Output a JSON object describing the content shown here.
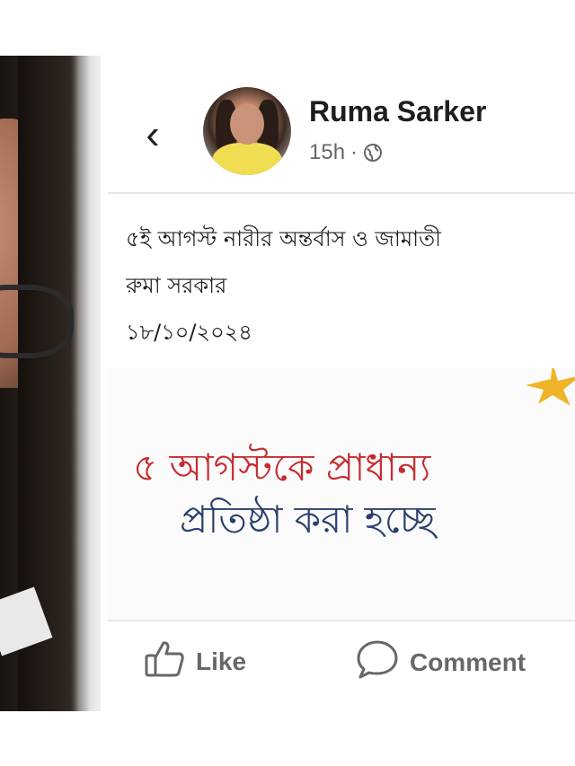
{
  "post": {
    "author_name": "Ruma Sarker",
    "time": "15h",
    "separator": "·",
    "privacy_icon": "globe-icon",
    "text_lines": [
      "৫ই আগস্ট নারীর অন্তর্বাস ও জামাতী",
      "রুমা সরকার",
      "১৮/১০/২০২৪"
    ],
    "image": {
      "headline_line1": "৫ আগস্টকে প্রাধান্য",
      "headline_line2": "প্রতিষ্ঠা করা হচ্ছে"
    }
  },
  "nav": {
    "back_icon": "chevron-left-icon"
  },
  "actions": {
    "like_label": "Like",
    "comment_label": "Comment"
  },
  "colors": {
    "headline_red": "#c62b2f",
    "headline_blue": "#2b3f6c",
    "muted_text": "#65676b",
    "avatar_shirt": "#f1dd52"
  }
}
